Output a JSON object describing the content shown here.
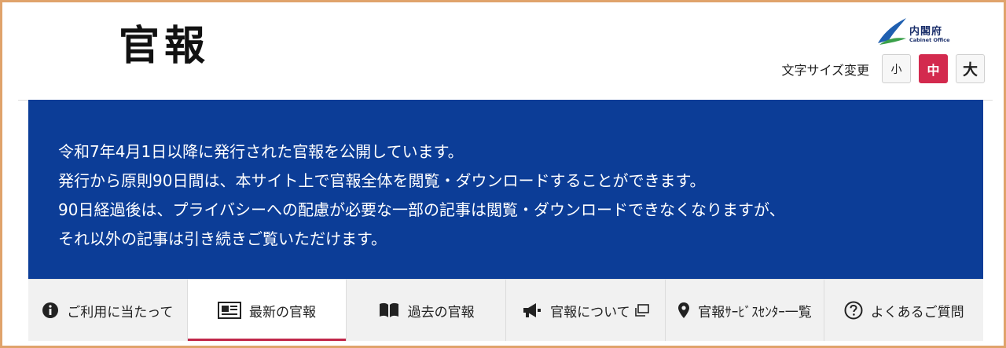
{
  "header": {
    "logo_text": "官報",
    "org_name": "内閣府",
    "org_sub": "Cabinet Office",
    "font_size": {
      "label": "文字サイズ変更",
      "options": [
        "小",
        "中",
        "大"
      ],
      "selected": "中"
    }
  },
  "notice": {
    "lines": [
      "令和7年4月1日以降に発行された官報を公開しています。",
      "発行から原則90日間は、本サイト上で官報全体を閲覧・ダウンロードすることができます。",
      "90日経過後は、プライバシーへの配慮が必要な一部の記事は閲覧・ダウンロードできなくなりますが、",
      "それ以外の記事は引き続きご覧いただけます。"
    ]
  },
  "nav": {
    "active": "最新の官報",
    "items": [
      {
        "label": "ご利用に当たって",
        "icon": "info-icon"
      },
      {
        "label": "最新の官報",
        "icon": "newspaper-icon"
      },
      {
        "label": "過去の官報",
        "icon": "book-icon"
      },
      {
        "label": "官報について",
        "icon": "megaphone-icon",
        "external_icon": "external-window-icon"
      },
      {
        "label": "官報ｻｰﾋﾞｽｾﾝﾀｰ一覧",
        "icon": "map-pin-icon"
      },
      {
        "label": "よくあるご質問",
        "icon": "question-circle-icon"
      }
    ]
  },
  "colors": {
    "notice_bg": "#0c3d97",
    "accent_red": "#d32a4e",
    "frame": "#e0a36b"
  }
}
